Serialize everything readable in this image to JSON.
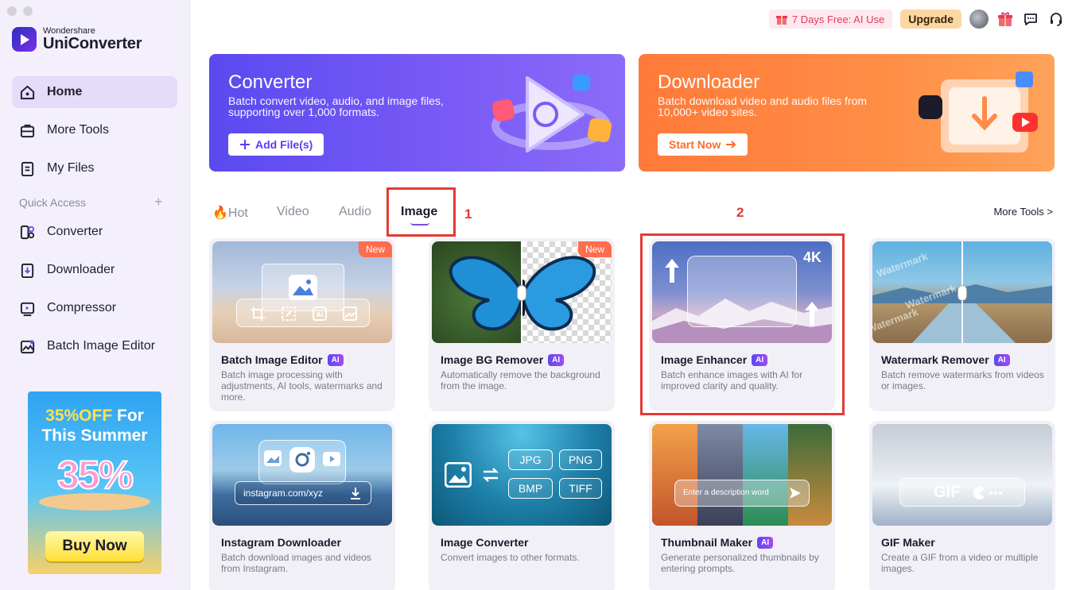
{
  "app": {
    "brand_sub": "Wondershare",
    "brand_main": "UniConverter"
  },
  "sidebar": {
    "items": [
      {
        "label": "Home",
        "icon": "home-icon"
      },
      {
        "label": "More Tools",
        "icon": "toolbox-icon"
      },
      {
        "label": "My Files",
        "icon": "file-icon"
      }
    ],
    "quick_access_label": "Quick Access",
    "quick_items": [
      {
        "label": "Converter",
        "icon": "converter-icon"
      },
      {
        "label": "Downloader",
        "icon": "downloader-icon"
      },
      {
        "label": "Compressor",
        "icon": "compressor-icon"
      },
      {
        "label": "Batch Image Editor",
        "icon": "image-editor-icon"
      }
    ],
    "promo": {
      "line1_highlight": "35%OFF",
      "line1_rest": " For",
      "line2": "This Summer",
      "big": "35%",
      "button": "Buy Now"
    }
  },
  "topbar": {
    "free_label": "7 Days Free: AI Use",
    "upgrade_label": "Upgrade"
  },
  "banners": {
    "converter": {
      "title": "Converter",
      "desc": "Batch convert video, audio, and image files, supporting over 1,000 formats.",
      "button": "Add File(s)"
    },
    "downloader": {
      "title": "Downloader",
      "desc": "Batch download video and audio files from 10,000+ video sites.",
      "button": "Start Now"
    }
  },
  "tabs": [
    {
      "label": "Hot"
    },
    {
      "label": "Video"
    },
    {
      "label": "Audio"
    },
    {
      "label": "Image",
      "active": true
    }
  ],
  "more_tools": "More Tools >",
  "annotations": [
    "1",
    "2"
  ],
  "cards": [
    {
      "title": "Batch Image Editor",
      "ai": "AI",
      "badge": "New",
      "desc": "Batch image processing with adjustments, AI tools, watermarks and more."
    },
    {
      "title": "Image BG Remover",
      "ai": "AI",
      "badge": "New",
      "desc": "Automatically remove the background from the image."
    },
    {
      "title": "Image Enhancer",
      "ai": "AI",
      "desc": "Batch enhance images with AI for improved clarity and quality.",
      "overlay": "4K"
    },
    {
      "title": "Watermark Remover",
      "ai": "AI",
      "desc": "Batch remove watermarks from videos or images.",
      "overlay": "Watermark"
    },
    {
      "title": "Instagram Downloader",
      "desc": "Batch download images and videos from Instagram.",
      "overlay": "instagram.com/xyz"
    },
    {
      "title": "Image Converter",
      "desc": "Convert images to other formats.",
      "formats": [
        "JPG",
        "PNG",
        "BMP",
        "TIFF"
      ]
    },
    {
      "title": "Thumbnail Maker",
      "ai": "AI",
      "desc": "Generate personalized thumbnails by entering prompts.",
      "overlay": "Enter a description word"
    },
    {
      "title": "GIF Maker",
      "desc": "Create a GIF from a video or multiple images.",
      "overlay": "GIF"
    }
  ],
  "colors": {
    "accent": "#7a4cf0",
    "converter": "#5a4af0",
    "downloader": "#ff7a3a",
    "annotation": "#e53935"
  }
}
